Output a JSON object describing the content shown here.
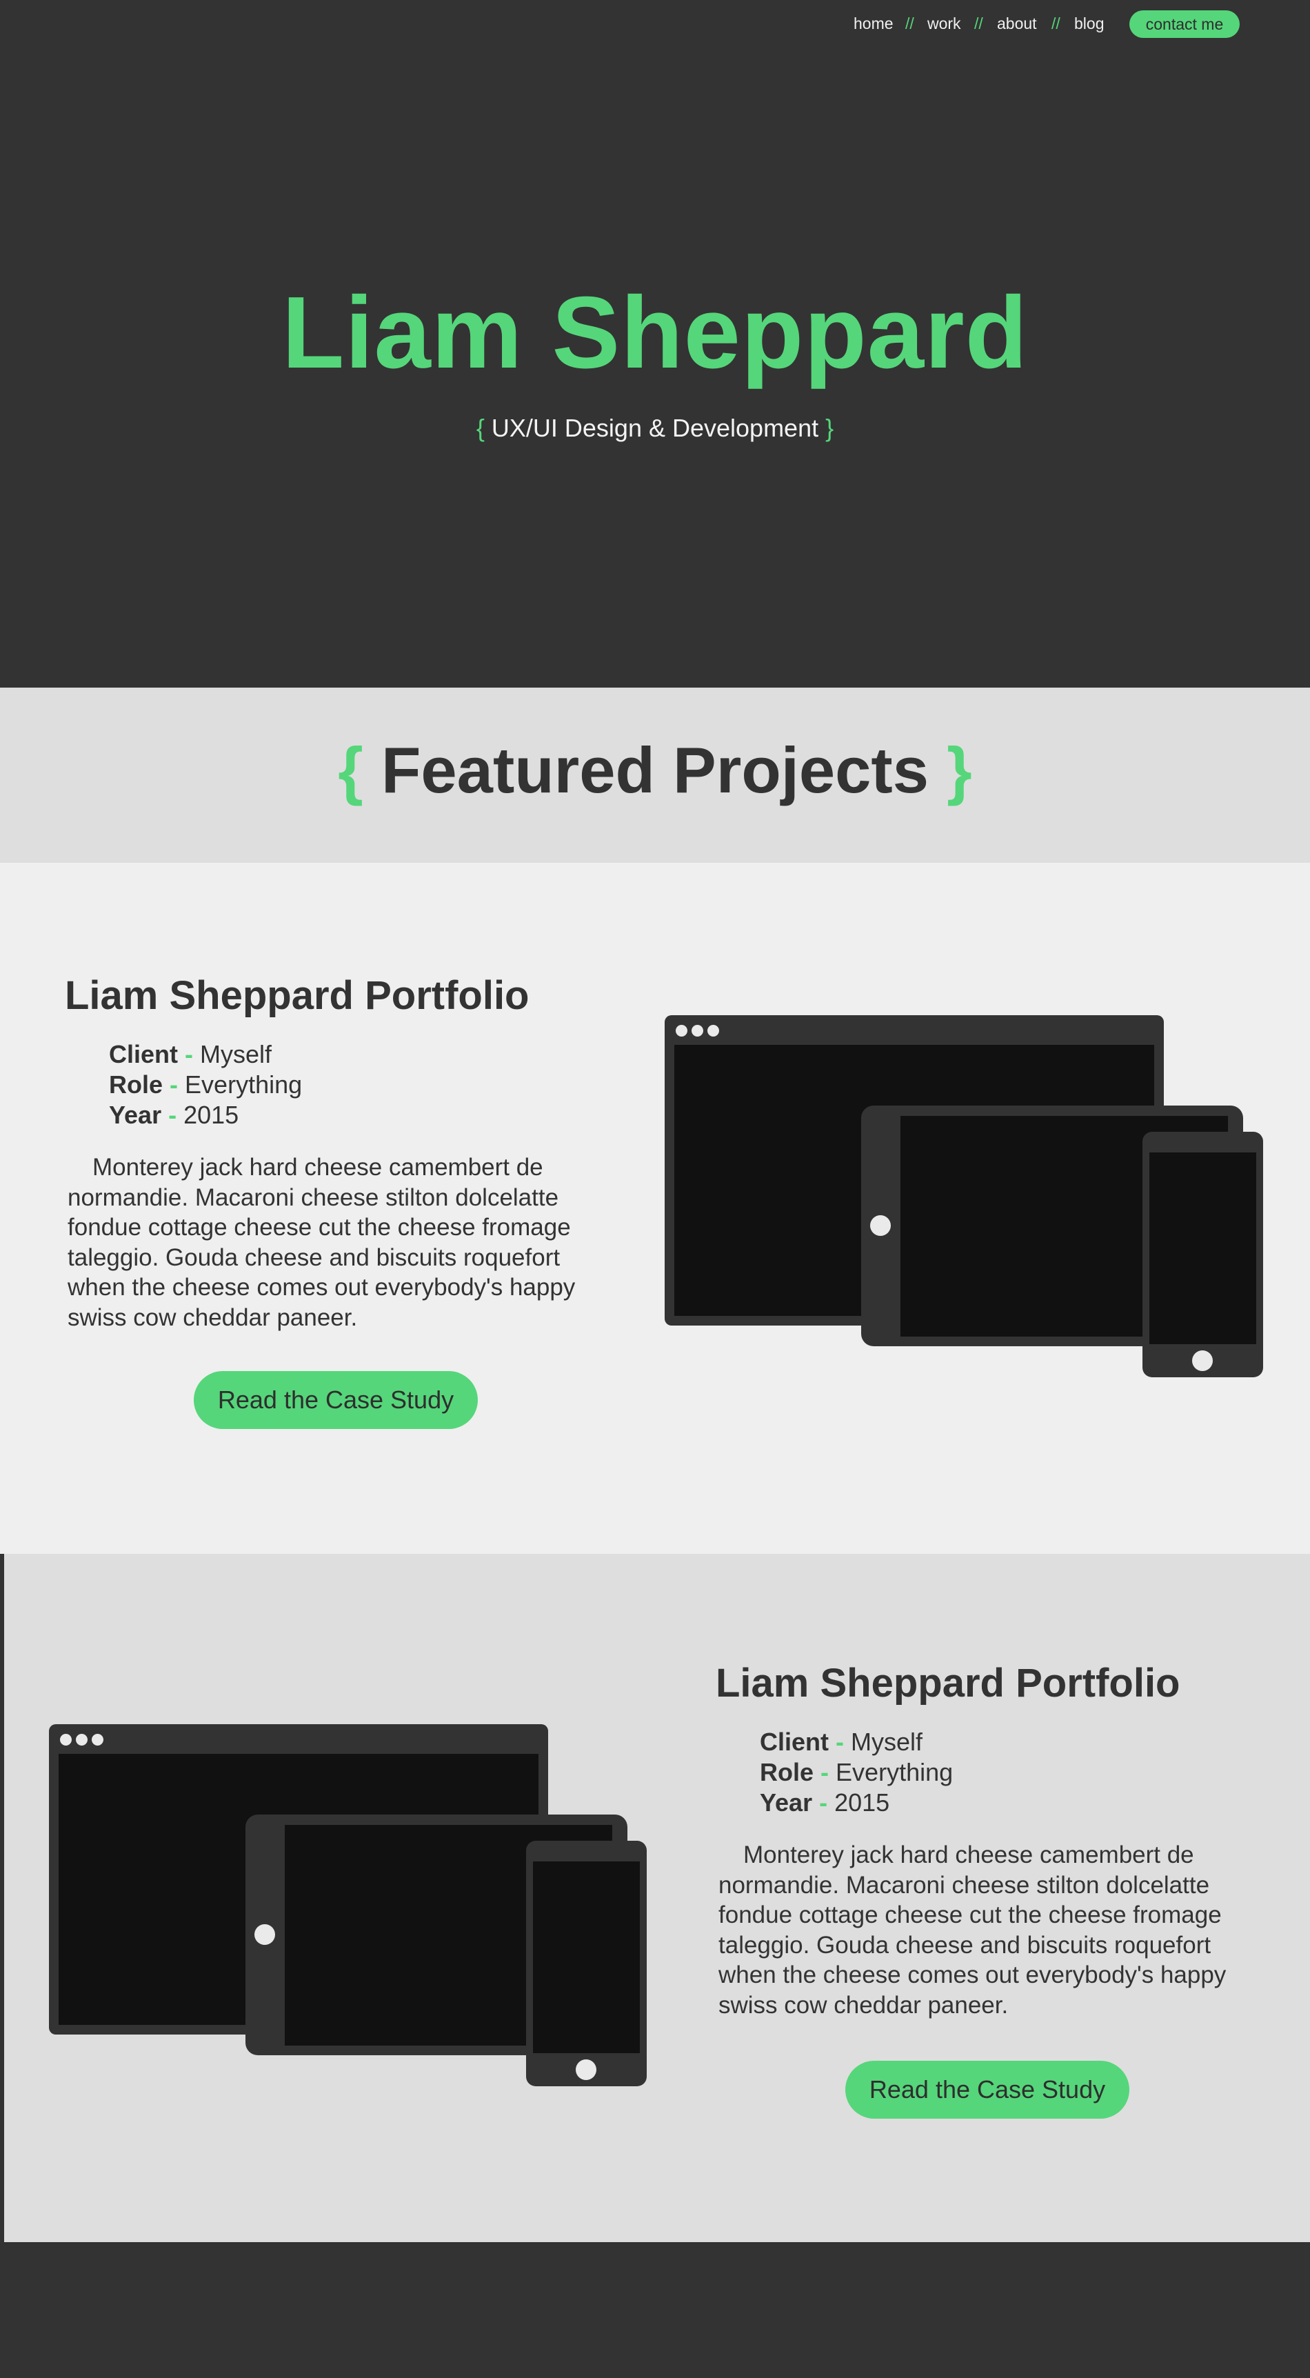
{
  "nav": {
    "items": [
      "home",
      "work",
      "about",
      "blog"
    ],
    "separator": "//",
    "contact_label": "contact me"
  },
  "hero": {
    "title": "Liam Sheppard",
    "brace_open": "{",
    "subtitle": "UX/UI Design & Development",
    "brace_close": "}"
  },
  "featured": {
    "brace_open": "{",
    "title": "Featured Projects",
    "brace_close": "}"
  },
  "projects": [
    {
      "title": "Liam Sheppard Portfolio",
      "client_label": "Client",
      "client_value": "Myself",
      "role_label": "Role",
      "role_value": "Everything",
      "year_label": "Year",
      "year_value": "2015",
      "dash": "-",
      "description": "Monterey jack hard cheese camembert de normandie. Macaroni cheese stilton dolcelatte fondue cottage cheese cut the cheese fromage taleggio. Gouda cheese and biscuits roquefort when the cheese comes out everybody's happy swiss cow cheddar paneer.",
      "cta_label": "Read the Case Study"
    },
    {
      "title": "Liam Sheppard Portfolio",
      "client_label": "Client",
      "client_value": "Myself",
      "role_label": "Role",
      "role_value": "Everything",
      "year_label": "Year",
      "year_value": "2015",
      "dash": "-",
      "description": "Monterey jack hard cheese camembert de normandie. Macaroni cheese stilton dolcelatte fondue cottage cheese cut the cheese fromage taleggio. Gouda cheese and biscuits roquefort when the cheese comes out everybody's happy swiss cow cheddar paneer.",
      "cta_label": "Read the Case Study"
    }
  ],
  "colors": {
    "accent": "#55d67a",
    "dark": "#333333",
    "light": "#efefef",
    "mid": "#dedede"
  }
}
